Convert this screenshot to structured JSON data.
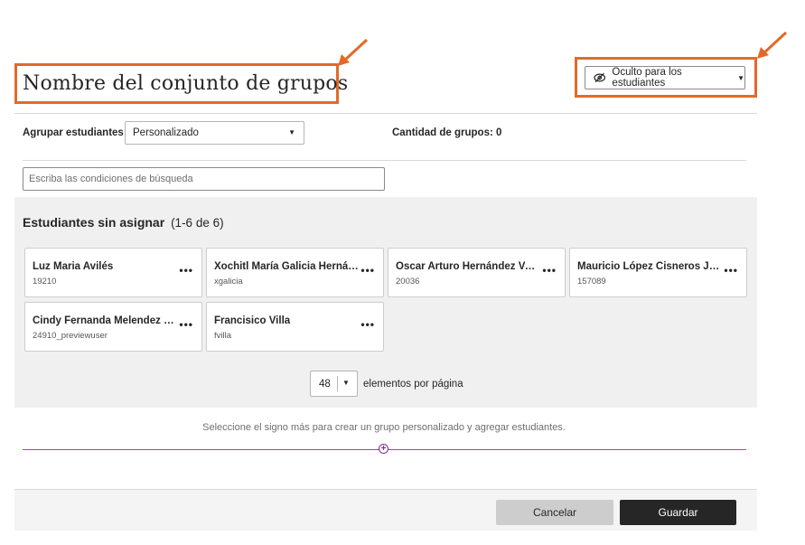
{
  "header": {
    "title": "Nombre del conjunto de grupos",
    "visibility_label": "Oculto para los estudiantes",
    "visibility_icon": "eye-slash-icon"
  },
  "controls": {
    "group_students_label": "Agrupar estudiantes",
    "group_mode_value": "Personalizado",
    "group_count_label": "Cantidad de grupos: 0",
    "search_placeholder": "Escriba las condiciones de búsqueda"
  },
  "unassigned": {
    "title": "Estudiantes sin asignar",
    "count": "(1-6 de 6)",
    "students": [
      {
        "name": "Luz Maria Avilés",
        "id": "19210"
      },
      {
        "name": "Xochitl María Galicia Hernández",
        "id": "xgalicia"
      },
      {
        "name": "Oscar Arturo Hernández Vazquez",
        "id": "20036"
      },
      {
        "name": "Mauricio López Cisneros Jiménez",
        "id": "157089"
      },
      {
        "name": "Cindy Fernanda Melendez Ruíz",
        "id": "24910_previewuser"
      },
      {
        "name": "Francisico Villa",
        "id": "fvilla"
      }
    ],
    "more_label": "•••"
  },
  "pagination": {
    "per_page": "48",
    "per_page_label": "elementos por página"
  },
  "groups": {
    "hint": "Seleccione el signo más para crear un grupo personalizado y agregar estudiantes.",
    "add_symbol": "+"
  },
  "footer": {
    "cancel_label": "Cancelar",
    "save_label": "Guardar"
  },
  "colors": {
    "annotation": "#e26a28",
    "accent_purple": "#a43eb5",
    "primary_button": "#262626"
  }
}
